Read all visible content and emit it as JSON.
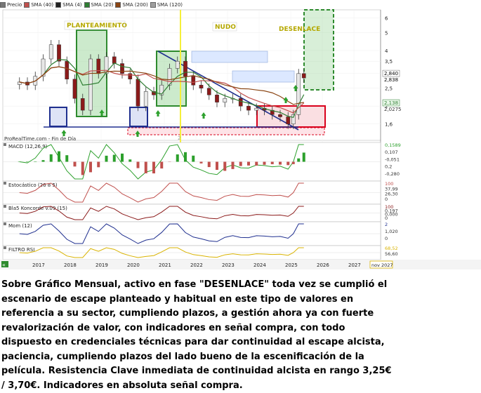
{
  "legend": {
    "items": [
      {
        "label": "Precio",
        "color": "#777777"
      },
      {
        "label": "SMA (40)",
        "color": "#c0504d"
      },
      {
        "label": "SMA (4)",
        "color": "#222222"
      },
      {
        "label": "SMA (20)",
        "color": "#2e7d32"
      },
      {
        "label": "SMA (200)",
        "color": "#8b4513"
      },
      {
        "label": "SMA (120)",
        "color": "#9e9e9e"
      }
    ]
  },
  "source_label": "ProRealTime.com - Fin de Día",
  "annotations": {
    "planteamiento": "PLANTEAMIENTO",
    "nudo": "NUDO",
    "desenlace": "DESENLACE",
    "vline_number": "2"
  },
  "price_axis": {
    "ticks": [
      "6",
      "5",
      "4",
      "3,5",
      "3",
      "2,5",
      "2",
      "1,6"
    ],
    "last_price": "2,840",
    "last_price_2": "2,838",
    "sma_a": "2,138",
    "sma_b": "2,0275"
  },
  "panels": [
    {
      "name": "MACD (12,26,9)",
      "right_labels": [
        "0,1589",
        "0,107",
        "-0,051",
        "0,2",
        "-0,280"
      ]
    },
    {
      "name": "Estocástico (26 8 5)",
      "right_labels": [
        "100",
        "37,99",
        "26,30",
        "0"
      ]
    },
    {
      "name": "Bla5 Koncorde v.09 (15)",
      "right_labels": [
        "100",
        "0,197",
        "0,000",
        "0"
      ]
    },
    {
      "name": "Mom (12)",
      "right_labels": [
        "2",
        "1,020",
        "0"
      ]
    },
    {
      "name": "FILTRO RSI",
      "right_labels": [
        "68,52",
        "56,60"
      ]
    }
  ],
  "time_axis": {
    "years": [
      "2017",
      "2018",
      "2019",
      "2020",
      "2021",
      "2022",
      "2023",
      "2024",
      "2025",
      "2026",
      "2027"
    ],
    "end_label": "nov 2027"
  },
  "chart_data": {
    "type": "candlestick",
    "title": "",
    "y_scale": "log",
    "ylim": [
      1.4,
      6.3
    ],
    "x": [
      "2016-06",
      "2016-09",
      "2016-12",
      "2017-03",
      "2017-06",
      "2017-09",
      "2017-12",
      "2018-03",
      "2018-06",
      "2018-09",
      "2018-12",
      "2019-03",
      "2019-06",
      "2019-09",
      "2019-12",
      "2020-03",
      "2020-06",
      "2020-09",
      "2020-12",
      "2021-03",
      "2021-06",
      "2021-09",
      "2021-12",
      "2022-03",
      "2022-06",
      "2022-09",
      "2022-12",
      "2023-03",
      "2023-06",
      "2023-09",
      "2023-12",
      "2024-03",
      "2024-06",
      "2024-09",
      "2024-12",
      "2025-02",
      "2025-04",
      "2025-06"
    ],
    "close": [
      2.7,
      2.6,
      2.9,
      3.6,
      4.3,
      3.5,
      2.8,
      2.2,
      1.9,
      3.6,
      3.0,
      3.7,
      3.4,
      3.0,
      2.8,
      2.0,
      2.4,
      2.3,
      2.6,
      3.2,
      3.5,
      2.9,
      2.6,
      2.5,
      2.3,
      2.1,
      2.2,
      2.2,
      2.0,
      1.9,
      1.95,
      1.9,
      1.8,
      1.75,
      1.6,
      1.8,
      3.0,
      2.84
    ],
    "levels": {
      "resistance": [
        3.25,
        3.7
      ],
      "last_price": 2.84
    },
    "indicators": [
      "MACD (12,26,9)",
      "Estocástico (26 8 5)",
      "Bla5 Koncorde v.09 (15)",
      "Mom (12)",
      "FILTRO RSI"
    ]
  },
  "caption": "Sobre Gráfico Mensual, activo en fase \"DESENLACE\"  toda vez se cumplió el escenario de escape planteado y habitual en este tipo de valores en referencia a su sector, cumpliendo plazos, a gestión ahora ya con fuerte revalorización de valor, con indicadores en señal compra, con todo dispuesto en credenciales técnicas para dar continuidad al escape alcista, paciencia, cumpliendo plazos del lado bueno de la escenificación de la película. Resistencia Clave inmediata de continuidad alcista en rango 3,25€ / 3,70€. Indicadores en absoluta señal compra.",
  "colors": {
    "green_box": "#2e8b2e",
    "green_fill": "#8fd18f",
    "red_box": "#d9001b",
    "blue_box": "#1f2f8f",
    "accent_yellow": "#f5ef3a"
  }
}
